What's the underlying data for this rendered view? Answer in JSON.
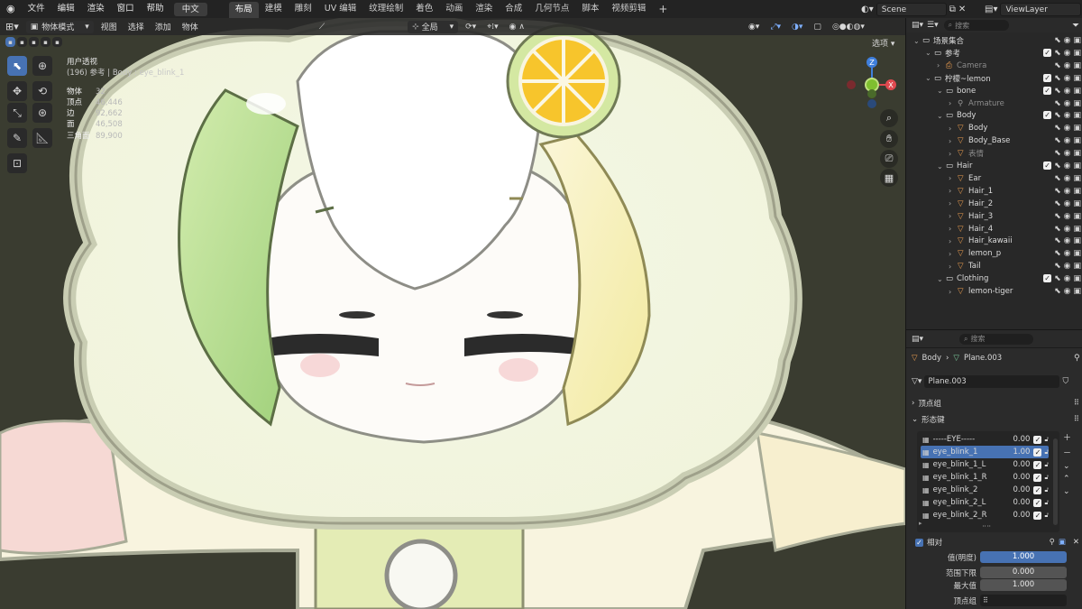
{
  "topbar": {
    "menus": [
      "文件",
      "编辑",
      "渲染",
      "窗口",
      "帮助"
    ],
    "language": "中文",
    "workspaces": [
      "布局",
      "建模",
      "雕刻",
      "UV 编辑",
      "纹理绘制",
      "着色",
      "动画",
      "渲染",
      "合成",
      "几何节点",
      "脚本",
      "视频剪辑"
    ],
    "active_workspace": "布局",
    "add_tab": "+",
    "scene": "Scene",
    "view_layer": "ViewLayer"
  },
  "viewport_header": {
    "mode": "物体模式",
    "menus": [
      "视图",
      "选择",
      "添加",
      "物体"
    ],
    "transform_orientation": "全局",
    "options": "选项"
  },
  "overlay_info": {
    "view_name": "用户透视",
    "object_line": "(196) 参考 | Body : eye_blink_1",
    "stats": [
      {
        "label": "物体",
        "value": "32"
      },
      {
        "label": "顶点",
        "value": "46,446"
      },
      {
        "label": "边",
        "value": "92,662"
      },
      {
        "label": "面",
        "value": "46,508"
      },
      {
        "label": "三角面",
        "value": "89,900"
      }
    ]
  },
  "gizmo": {
    "z": "Z",
    "y": "Y",
    "x": "X"
  },
  "outliner": {
    "search_placeholder": "搜索",
    "items": [
      {
        "label": "场景集合",
        "level": 0
      },
      {
        "label": "参考",
        "level": 1
      },
      {
        "label": "Camera",
        "level": 2,
        "dim": true
      },
      {
        "label": "柠檬~lemon",
        "level": 1
      },
      {
        "label": "bone",
        "level": 2
      },
      {
        "label": "Armature",
        "level": 3,
        "dim": true
      },
      {
        "label": "Body",
        "level": 2
      },
      {
        "label": "Body",
        "level": 3
      },
      {
        "label": "Body_Base",
        "level": 3
      },
      {
        "label": "表情",
        "level": 3,
        "dim": true
      },
      {
        "label": "Hair",
        "level": 2
      },
      {
        "label": "Ear",
        "level": 3
      },
      {
        "label": "Hair_1",
        "level": 3
      },
      {
        "label": "Hair_2",
        "level": 3
      },
      {
        "label": "Hair_3",
        "level": 3
      },
      {
        "label": "Hair_4",
        "level": 3
      },
      {
        "label": "Hair_kawaii",
        "level": 3
      },
      {
        "label": "lemon_p",
        "level": 3
      },
      {
        "label": "Tail",
        "level": 3
      },
      {
        "label": "Clothing",
        "level": 2
      },
      {
        "label": "lemon-tiger",
        "level": 3
      }
    ]
  },
  "properties": {
    "search_placeholder": "搜索",
    "breadcrumb": {
      "object": "Body",
      "data": "Plane.003"
    },
    "mesh_name": "Plane.003",
    "panels": {
      "vertex_groups": "顶点组",
      "shape_keys": "形态键"
    },
    "shape_keys": [
      {
        "name": "-----EYE-----",
        "value": "0.00"
      },
      {
        "name": "eye_blink_1",
        "value": "1.00",
        "selected": true
      },
      {
        "name": "eye_blink_1_L",
        "value": "0.00"
      },
      {
        "name": "eye_blink_1_R",
        "value": "0.00"
      },
      {
        "name": "eye_blink_2",
        "value": "0.00"
      },
      {
        "name": "eye_blink_2_L",
        "value": "0.00"
      },
      {
        "name": "eye_blink_2_R",
        "value": "0.00"
      }
    ],
    "relative_label": "相对",
    "fields": {
      "value_label": "值(明度)",
      "value": "1.000",
      "range_min_label": "范围下限",
      "range_min": "0.000",
      "max_label": "最大值",
      "max": "1.000",
      "vertex_group_label": "顶点组"
    }
  },
  "colors": {
    "accent": "#4772b3",
    "viewport_bg": "#393b2f",
    "hair_green": "#cfe9a8",
    "lemon_yellow": "#f5d23a",
    "gizmo_x": "#e0494f",
    "gizmo_y": "#7fbf2f",
    "gizmo_z": "#3f7fdc"
  }
}
